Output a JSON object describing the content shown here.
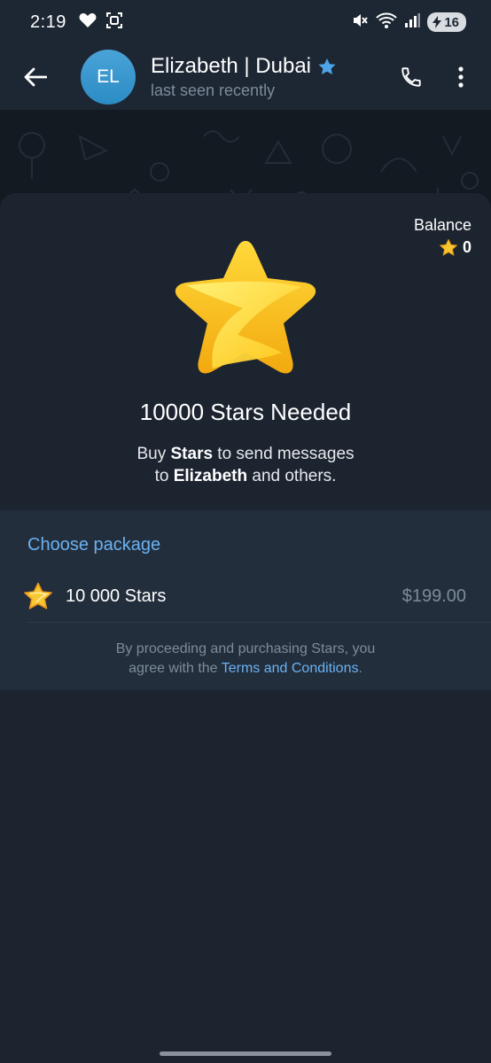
{
  "status_bar": {
    "time": "2:19",
    "battery": "16"
  },
  "header": {
    "avatar_initials": "EL",
    "name": "Elizabeth | Dubai",
    "status": "last seen recently",
    "icons": [
      "back-arrow-icon",
      "premium-star-icon",
      "phone-icon",
      "more-vertical-icon"
    ]
  },
  "sheet": {
    "balance_label": "Balance",
    "balance_value": "0",
    "title": "10000 Stars Needed",
    "subtitle_line1_prefix": "Buy ",
    "subtitle_line1_bold": "Stars",
    "subtitle_line1_suffix": " to send messages",
    "subtitle_line2_prefix": "to ",
    "subtitle_line2_bold": "Elizabeth",
    "subtitle_line2_suffix": " and others."
  },
  "packages": {
    "heading": "Choose package",
    "items": [
      {
        "label": "10 000 Stars",
        "price": "$199.00"
      }
    ]
  },
  "terms": {
    "line1": "By proceeding and purchasing Stars, you",
    "line2_prefix": "agree with the ",
    "link": "Terms and Conditions",
    "line2_suffix": "."
  },
  "colors": {
    "accent": "#6ab2f2",
    "star_gold": "#f7c531",
    "background": "#1c2430",
    "panel": "#232e3c"
  }
}
